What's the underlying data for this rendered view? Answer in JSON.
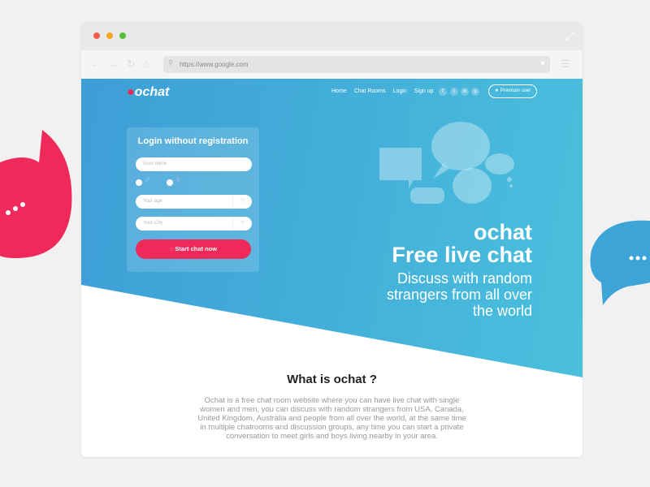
{
  "browser": {
    "url": "https://www.google.com",
    "dots": [
      "#f25c4b",
      "#f7a823",
      "#56c03a"
    ]
  },
  "site": {
    "logo": "ochat",
    "menu": [
      "Home",
      "Chat Rooms",
      "Login",
      "Sign up"
    ],
    "social": [
      "f",
      "t",
      "in",
      "p"
    ],
    "premium": "Premium user"
  },
  "form": {
    "title": "Login without registration",
    "username_placeholder": "User name",
    "male": "♂",
    "female": "♀",
    "age_placeholder": "Your age",
    "city_placeholder": "Your City",
    "submit": "Start chat now"
  },
  "hero": {
    "line1": "ochat",
    "line2": "Free live chat",
    "tagline": [
      "Discuss with random",
      "strangers from all over",
      "the world"
    ]
  },
  "about": {
    "title": "What is ochat ?",
    "text": "Ochat is a free chat room website where you can have live chat with single women and men, you can discuss with random strangers from USA, Canada, United Kingdom, Australia and people from all over the world, at the same time in multiple chatrooms and discussion groups, any time you can start a private conversation to meet girls and boys living nearby in your area."
  },
  "colors": {
    "accent": "#ef2a5a",
    "blue": "#3da4d8"
  }
}
